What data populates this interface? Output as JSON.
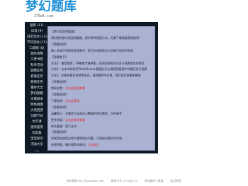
{
  "logo": {
    "title": "梦幻题库",
    "subtitle": "175dt.com"
  },
  "sidebar": {
    "items": [
      {
        "label": "题库 (11)"
      },
      {
        "label": "日常 (9)"
      },
      {
        "label": "日常活动 (13)"
      },
      {
        "label": "节日活动 (11)"
      },
      {
        "label": "口袋版 (8)"
      },
      {
        "label": "副本攻略"
      },
      {
        "label": "三界书院"
      },
      {
        "label": "科举活动"
      },
      {
        "label": "剧情任务"
      },
      {
        "label": "抓鬼任务"
      },
      {
        "label": "跑商任务"
      },
      {
        "label": "秦岭大全"
      },
      {
        "label": "梦幻秘籍"
      },
      {
        "label": "水墨剧本"
      },
      {
        "label": "特色地图"
      },
      {
        "label": "大话西游"
      },
      {
        "label": "创建节日"
      },
      {
        "label": "文学课"
      },
      {
        "label": "唐诗鉴赏"
      },
      {
        "label": "答案集"
      },
      {
        "label": "宝宝知识"
      },
      {
        "label": "活动大全"
      }
    ],
    "more_label": "..."
  },
  "content": {
    "lines": [
      {
        "text": "【梦幻西游答题器】"
      },
      {
        "text": "同时使用梦幻西游答题器，提供多种搜索方式，无需下载就能直接使用！"
      },
      {
        "text": "【答题说明】"
      },
      {
        "text": "输入关键字到搜索框里面中，即可自动搜索出与关键字相关的答案"
      },
      {
        "text": "【答题助手】"
      },
      {
        "text": "方法1：使用搜索，58尊者字典原题，在网页框框内可自行搜索相应的答案"
      },
      {
        "text": "方法2：在本书的网页PhotoScreen截图后可以直接把截图中的题目进行搜索"
      },
      {
        "text": "方法3：如果有题目答错率较高，请到题库中反馈，我们会尽快更新整理"
      },
      {
        "text": "【答题说明】"
      },
      {
        "text": "错误次数：",
        "highlight": "点击此链接查看"
      },
      {
        "text": "【答题说明】"
      },
      {
        "text": "下载链接：",
        "highlight": "点击此链接"
      },
      {
        "text": "【答题说明】"
      },
      {
        "text": "温馨提示：本题库为玩家自己整理的梦幻题库，仅供参考"
      },
      {
        "text": "更多答案：",
        "highlight": "点击此链接查看"
      },
      {
        "text": "联系客服：暂不支持"
      },
      {
        "text": "【答题说明】"
      },
      {
        "text": "如果您在使用过程中遇到相关问题，可直接在题目中反馈"
      },
      {
        "text": "快速答题，最好搜索关键词。",
        "highlight": "点击留言"
      }
    ]
  },
  "footer": {
    "links": [
      "梦幻题库 dt17@outlook.com",
      "联系方式 7312@175",
      "梦幻题库工具箱",
      "站点地图"
    ]
  }
}
